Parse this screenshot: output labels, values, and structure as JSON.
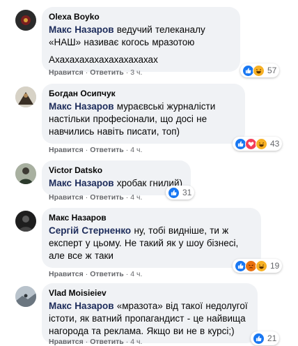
{
  "comments": [
    {
      "author": "Olexa Boyko",
      "mention": "Макс Назаров",
      "text": " ведучий телеканалу «НАШ» називає когось мразотою",
      "text2": "Ахахахахахахахахахахах",
      "like_label": "Нравится",
      "reply_label": "Ответить",
      "time": "3 ч.",
      "reaction_count": "57",
      "reactions": [
        "like-icon",
        "haha-icon"
      ]
    },
    {
      "author": "Богдан Осипчук",
      "mention": "Макс Назаров",
      "text": " мураєвські журналісти настільки професіонали, що досі не навчились навіть писати, топ)",
      "like_label": "Нравится",
      "reply_label": "Ответить",
      "time": "4 ч.",
      "reaction_count": "43",
      "reactions": [
        "like-icon",
        "love-icon",
        "haha-icon"
      ]
    },
    {
      "author": "Victor Datsko",
      "mention": "Макс Назаров",
      "text": " хробак гнилий)",
      "like_label": "Нравится",
      "reply_label": "Ответить",
      "time": "4 ч.",
      "reaction_count": "31",
      "reactions": [
        "like-icon"
      ]
    },
    {
      "author": "Макс Назаров",
      "mention": "Сергій Стерненко",
      "text": " ну, тобі видніше, ти ж експерт у цьому. Не такий як у шоу бізнесі, але все ж таки",
      "like_label": "Нравится",
      "reply_label": "Ответить",
      "time": "4 ч.",
      "reaction_count": "19",
      "reactions": [
        "like-icon",
        "angry-icon",
        "haha-icon"
      ]
    },
    {
      "author": "Vlad Moisieiev",
      "mention": "Макс Назаров",
      "text": " «мразота» від такої недолугої істоти, як ватний пропагандист - це найвища нагорода та реклама. Якщо ви не в курсі;)",
      "like_label": "Нравится",
      "reply_label": "Ответить",
      "time": "4 ч.",
      "reaction_count": "21",
      "reactions": [
        "like-icon"
      ]
    }
  ],
  "colors": {
    "bubble": "#f0f2f5",
    "meta": "#65676b",
    "like": "#1877f2",
    "love": "#f33e58",
    "haha": "#f7b125",
    "angry": "#e9710f"
  }
}
